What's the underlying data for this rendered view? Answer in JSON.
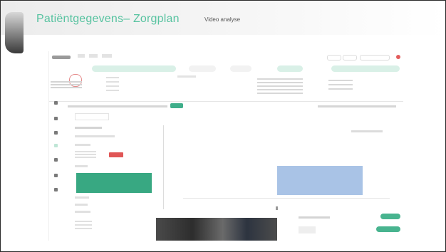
{
  "slide": {
    "title": "Patiëntgegevens– Zorgplan",
    "subtitle": "Video analyse"
  },
  "colors": {
    "accent": "#57c3a0",
    "selected_green": "#38a882",
    "alert_red": "#e05656",
    "bar_blue": "#a9c3e6"
  }
}
